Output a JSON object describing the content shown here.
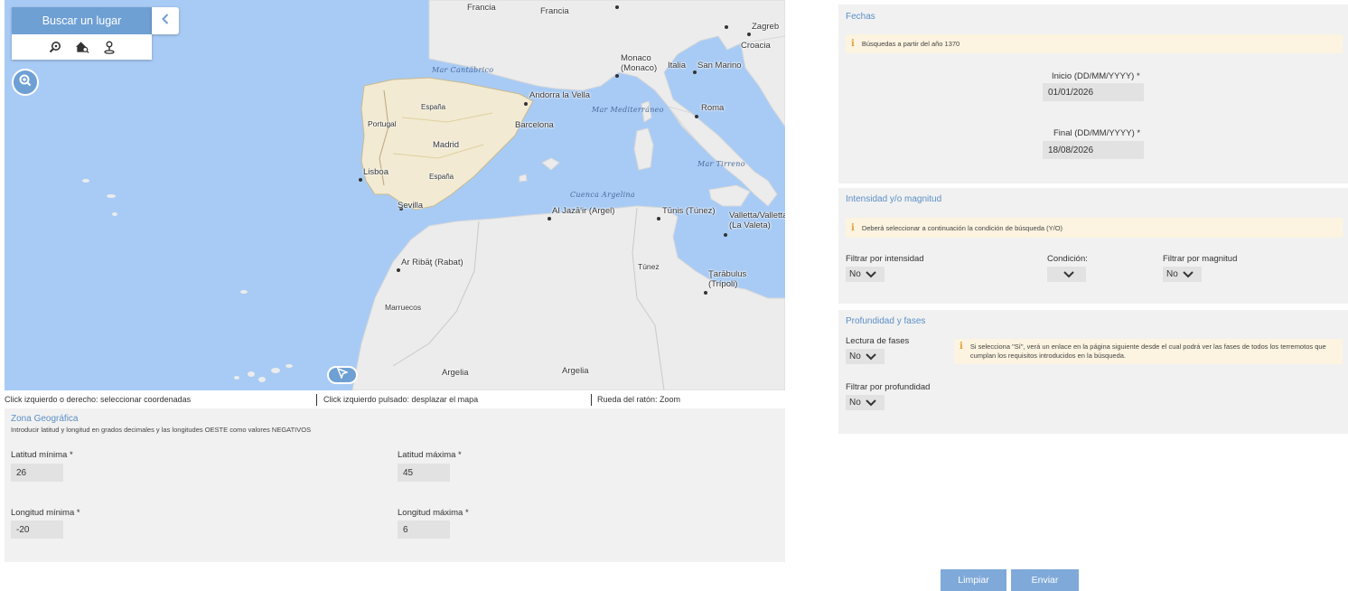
{
  "map": {
    "search_title": "Buscar un lugar",
    "tools": [
      "search-place-icon",
      "home-search-icon",
      "pin-icon"
    ],
    "city_labels": [
      {
        "name": "city-francia",
        "text": "Francia"
      },
      {
        "name": "city-francia2",
        "text": "Francia"
      },
      {
        "name": "city-zagreb",
        "text": "Zagreb"
      },
      {
        "name": "city-croacia",
        "text": "Croacia"
      },
      {
        "name": "city-monaco",
        "text": "Monaco"
      },
      {
        "name": "city-monaco2",
        "text": "(Monaco)"
      },
      {
        "name": "city-italia",
        "text": "Italia"
      },
      {
        "name": "city-san-marino",
        "text": "San Marino"
      },
      {
        "name": "city-andorra",
        "text": "Andorra la Vella"
      },
      {
        "name": "city-barcelona",
        "text": "Barcelona"
      },
      {
        "name": "city-roma",
        "text": "Roma"
      },
      {
        "name": "city-espana",
        "text": "España"
      },
      {
        "name": "city-portugal",
        "text": "Portugal"
      },
      {
        "name": "city-madrid",
        "text": "Madrid"
      },
      {
        "name": "city-lisboa",
        "text": "Lisboa"
      },
      {
        "name": "city-espana2",
        "text": "España"
      },
      {
        "name": "city-sevilla",
        "text": "Sevilla"
      },
      {
        "name": "city-argel",
        "text": "Al Jazā'ir (Argel)"
      },
      {
        "name": "city-tunis",
        "text": "Tūnis (Túnez)"
      },
      {
        "name": "city-valletta",
        "text": "Valletta/Valletta"
      },
      {
        "name": "city-valeta",
        "text": "(La Valeta)"
      },
      {
        "name": "city-rabat",
        "text": "Ar Ribāţ (Rabat)"
      },
      {
        "name": "city-tunez",
        "text": "Túnez"
      },
      {
        "name": "city-tarabulus",
        "text": "Ţarābulus"
      },
      {
        "name": "city-tripoli",
        "text": "(Trípoli)"
      },
      {
        "name": "city-marruecos",
        "text": "Marruecos"
      },
      {
        "name": "city-argelia",
        "text": "Argelia"
      },
      {
        "name": "city-argelia2",
        "text": "Argelia"
      }
    ],
    "sea_labels": [
      {
        "name": "sea-cantabrico",
        "text": "Mar Cantábrico"
      },
      {
        "name": "sea-mediterraneo",
        "text": "Mar Mediterráneo"
      },
      {
        "name": "sea-tirreno",
        "text": "Mar Tirreno"
      },
      {
        "name": "sea-argelina",
        "text": "Cuenca Argelina"
      }
    ]
  },
  "hints": [
    "Click izquierdo o derecho: seleccionar coordenadas",
    "Click izquierdo pulsado: desplazar el mapa",
    "Rueda del ratón: Zoom"
  ],
  "zona": {
    "title": "Zona Geográfica",
    "description": "Introducir latitud y longitud en grados decimales y las longitudes OESTE como valores NEGATIVOS",
    "lat_min_label": "Latitud mínima *",
    "lat_min_value": "26",
    "lat_max_label": "Latitud máxima *",
    "lat_max_value": "45",
    "lon_min_label": "Longitud mínima *",
    "lon_min_value": "-20",
    "lon_max_label": "Longitud máxima *",
    "lon_max_value": "6"
  },
  "fechas": {
    "title": "Fechas",
    "info": "Búsquedas a partir del año 1370",
    "start_label": "Inicio (DD/MM/YYYY) *",
    "start_value": "01/01/2026",
    "end_label": "Final (DD/MM/YYYY) *",
    "end_value": "18/08/2026"
  },
  "intensidad": {
    "title": "Intensidad y/o magnitud",
    "info": "Deberá seleccionar a continuación la condición de búsqueda (Y/O)",
    "intensity_label": "Filtrar por intensidad",
    "intensity_value": "No",
    "condition_label": "Condición:",
    "condition_value": "",
    "magnitude_label": "Filtrar por magnitud",
    "magnitude_value": "No"
  },
  "profundidad": {
    "title": "Profundidad y fases",
    "phases_label": "Lectura de fases",
    "phases_value": "No",
    "info": "Si selecciona \"Sí\", verá un enlace en la página siguiente desde el cual podrá ver las fases de todos los terremotos que cumplan los requisitos introducidos en la búsqueda.",
    "depth_label": "Filtrar por profundidad",
    "depth_value": "No"
  },
  "actions": {
    "clear_label": "Limpiar",
    "submit_label": "Enviar"
  },
  "colors": {
    "accent": "#6ea0d4",
    "button": "#7fa9d8",
    "sea": "#a8cbf5",
    "land": "#ececec",
    "spain": "#f2ead2",
    "panel": "#f1f1f1",
    "info_bg": "#fcf3e0",
    "title_text": "#5b8fc7"
  }
}
